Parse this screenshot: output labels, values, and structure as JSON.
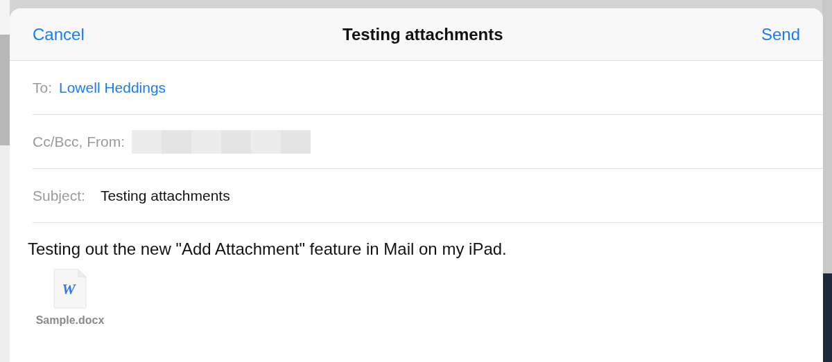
{
  "header": {
    "cancel": "Cancel",
    "title": "Testing attachments",
    "send": "Send"
  },
  "fields": [
    {
      "kind": "recipients",
      "label": "To:",
      "value": "Lowell Heddings"
    },
    {
      "kind": "redacted",
      "label": "Cc/Bcc, From:"
    },
    {
      "kind": "text",
      "label": "Subject:",
      "value": "Testing attachments"
    }
  ],
  "body": {
    "text": "Testing out the new \"Add Attachment\" feature in Mail on my iPad."
  },
  "attachments": [
    {
      "icon_letter": "W",
      "name": "Sample.docx"
    }
  ]
}
